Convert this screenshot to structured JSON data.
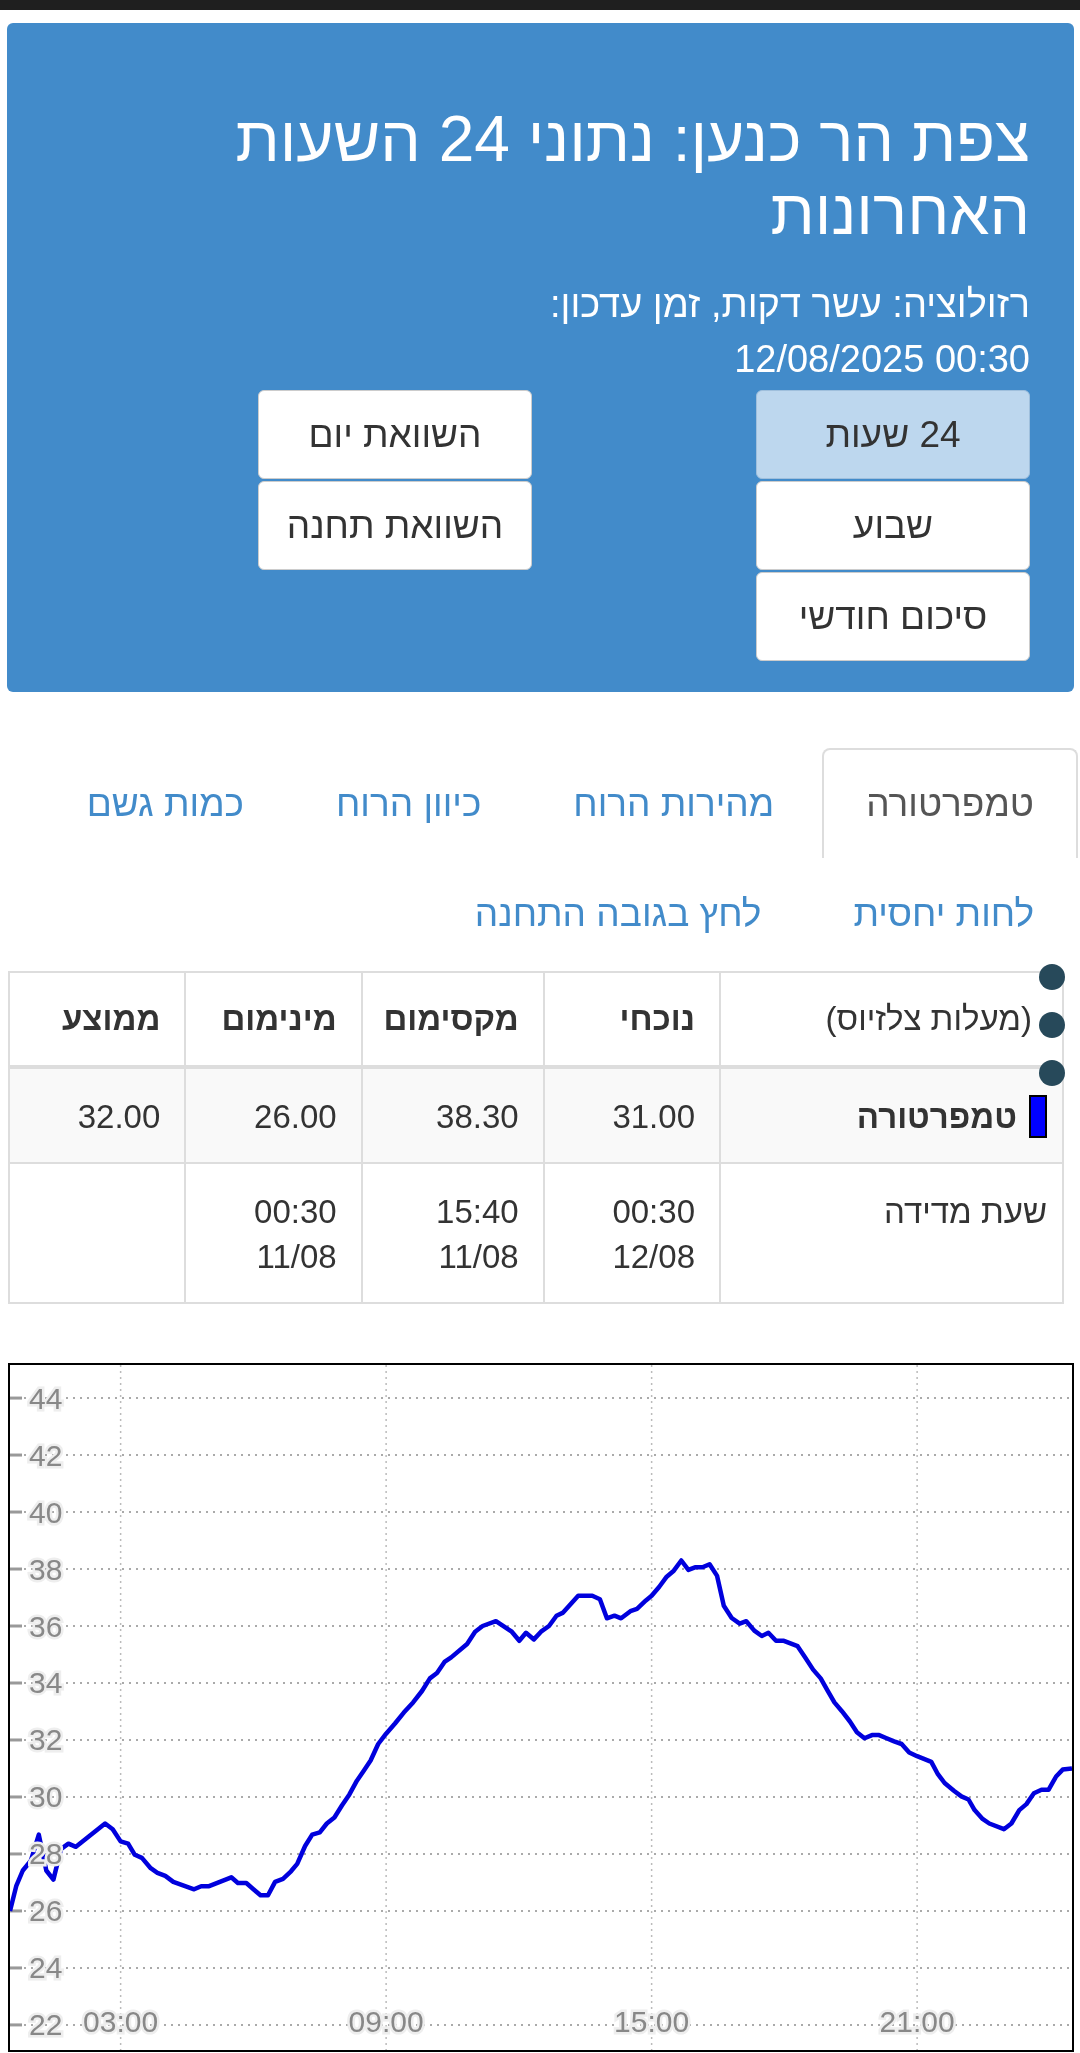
{
  "header": {
    "title": "צפת הר כנען: נתוני 24 השעות האחרונות",
    "resolution": "רזולוציה: עשר דקות, זמן עדכון:",
    "updated": "12/08/2025 00:30",
    "period_buttons": [
      {
        "label": "24 שעות",
        "selected": true
      },
      {
        "label": "שבוע",
        "selected": false
      },
      {
        "label": "סיכום חודשי",
        "selected": false
      }
    ],
    "compare_buttons": [
      {
        "label": "השוואת יום"
      },
      {
        "label": "השוואת תחנה"
      }
    ]
  },
  "tabs": [
    {
      "label": "טמפרטורה",
      "selected": true
    },
    {
      "label": "מהירות הרוח",
      "selected": false
    },
    {
      "label": "כיוון הרוח",
      "selected": false
    },
    {
      "label": "כמות גשם",
      "selected": false
    },
    {
      "label": "לחות יחסית",
      "selected": false
    },
    {
      "label": "לחץ בגובה התחנה",
      "selected": false
    }
  ],
  "table": {
    "columns": [
      "(מעלות צלזיוס)",
      "נוכחי",
      "מקסימום",
      "מינימום",
      "ממוצע"
    ],
    "rows": [
      {
        "kind": "series",
        "color": "#0000ff",
        "cells": [
          "טמפרטורה",
          "31.00",
          "38.30",
          "26.00",
          "32.00"
        ]
      },
      {
        "kind": "time",
        "cells": [
          "שעת מדידה",
          "00:30\n12/08",
          "15:40\n11/08",
          "00:30\n11/08"
        ]
      }
    ]
  },
  "chart": {
    "chart_data": {
      "type": "line",
      "grid": true,
      "xlim": [
        0.5,
        24.5
      ],
      "ylim": [
        21.12,
        45.16
      ],
      "xticks": [
        {
          "value": 3,
          "label": "03:00"
        },
        {
          "value": 9,
          "label": "09:00"
        },
        {
          "value": 15,
          "label": "15:00"
        },
        {
          "value": 21,
          "label": "21:00"
        }
      ],
      "yticks": [
        22,
        24,
        26,
        28,
        30,
        32,
        34,
        36,
        38,
        40,
        42,
        44
      ],
      "x": [
        0.5,
        0.64,
        0.79,
        0.97,
        1.15,
        1.32,
        1.48,
        1.65,
        1.82,
        1.99,
        2.65,
        2.82,
        3.0,
        3.17,
        3.32,
        3.48,
        3.68,
        3.83,
        4.01,
        4.19,
        4.66,
        4.82,
        5.0,
        5.5,
        5.65,
        5.84,
        6.16,
        6.33,
        6.49,
        6.67,
        6.85,
        6.99,
        7.17,
        7.33,
        7.5,
        7.66,
        7.83,
        8.0,
        8.17,
        8.34,
        8.49,
        8.65,
        8.82,
        9.0,
        9.2,
        9.4,
        9.61,
        9.81,
        9.99,
        10.15,
        10.32,
        10.47,
        10.83,
        11.01,
        11.18,
        11.48,
        11.84,
        12.01,
        12.16,
        12.34,
        12.5,
        12.68,
        12.85,
        13.0,
        13.34,
        13.66,
        13.83,
        13.99,
        14.16,
        14.31,
        14.52,
        14.67,
        14.87,
        15.0,
        15.17,
        15.34,
        15.5,
        15.67,
        15.83,
        15.98,
        16.15,
        16.31,
        16.48,
        16.63,
        16.81,
        16.99,
        17.14,
        17.32,
        17.49,
        17.64,
        17.81,
        17.99,
        18.3,
        18.47,
        18.65,
        18.82,
        18.97,
        19.13,
        19.3,
        19.48,
        19.64,
        19.81,
        19.98,
        20.14,
        20.31,
        20.48,
        20.65,
        20.82,
        21.0,
        21.32,
        21.47,
        21.62,
        21.83,
        22.0,
        22.16,
        22.3,
        22.48,
        22.63,
        22.96,
        23.13,
        23.31,
        23.47,
        23.64,
        23.81,
        23.97,
        24.14,
        24.29,
        24.5
      ],
      "series": [
        {
          "color": "#0000dd",
          "values": [
            26.0,
            26.87,
            27.42,
            27.76,
            28.68,
            27.42,
            27.1,
            28.17,
            28.36,
            28.25,
            29.07,
            28.87,
            28.44,
            28.36,
            27.97,
            27.86,
            27.5,
            27.34,
            27.23,
            27.02,
            26.76,
            26.87,
            26.87,
            27.18,
            26.98,
            26.98,
            26.55,
            26.55,
            27.02,
            27.13,
            27.39,
            27.65,
            28.28,
            28.68,
            28.76,
            29.07,
            29.28,
            29.7,
            30.09,
            30.57,
            30.91,
            31.28,
            31.86,
            32.22,
            32.58,
            32.96,
            33.32,
            33.72,
            34.16,
            34.35,
            34.74,
            34.9,
            35.37,
            35.8,
            36.0,
            36.17,
            35.8,
            35.48,
            35.76,
            35.53,
            35.8,
            36.0,
            36.36,
            36.47,
            37.06,
            37.06,
            36.94,
            36.27,
            36.36,
            36.27,
            36.52,
            36.6,
            36.9,
            37.06,
            37.37,
            37.73,
            37.94,
            38.3,
            37.97,
            38.06,
            38.06,
            38.17,
            37.76,
            36.71,
            36.28,
            36.08,
            36.17,
            35.84,
            35.65,
            35.76,
            35.48,
            35.48,
            35.29,
            34.9,
            34.47,
            34.16,
            33.75,
            33.32,
            33.01,
            32.65,
            32.27,
            32.06,
            32.17,
            32.17,
            32.06,
            31.95,
            31.86,
            31.56,
            31.43,
            31.23,
            30.8,
            30.49,
            30.22,
            30.02,
            29.91,
            29.54,
            29.23,
            29.07,
            28.87,
            29.07,
            29.54,
            29.75,
            30.13,
            30.25,
            30.25,
            30.72,
            30.96,
            31.0
          ]
        }
      ]
    }
  }
}
